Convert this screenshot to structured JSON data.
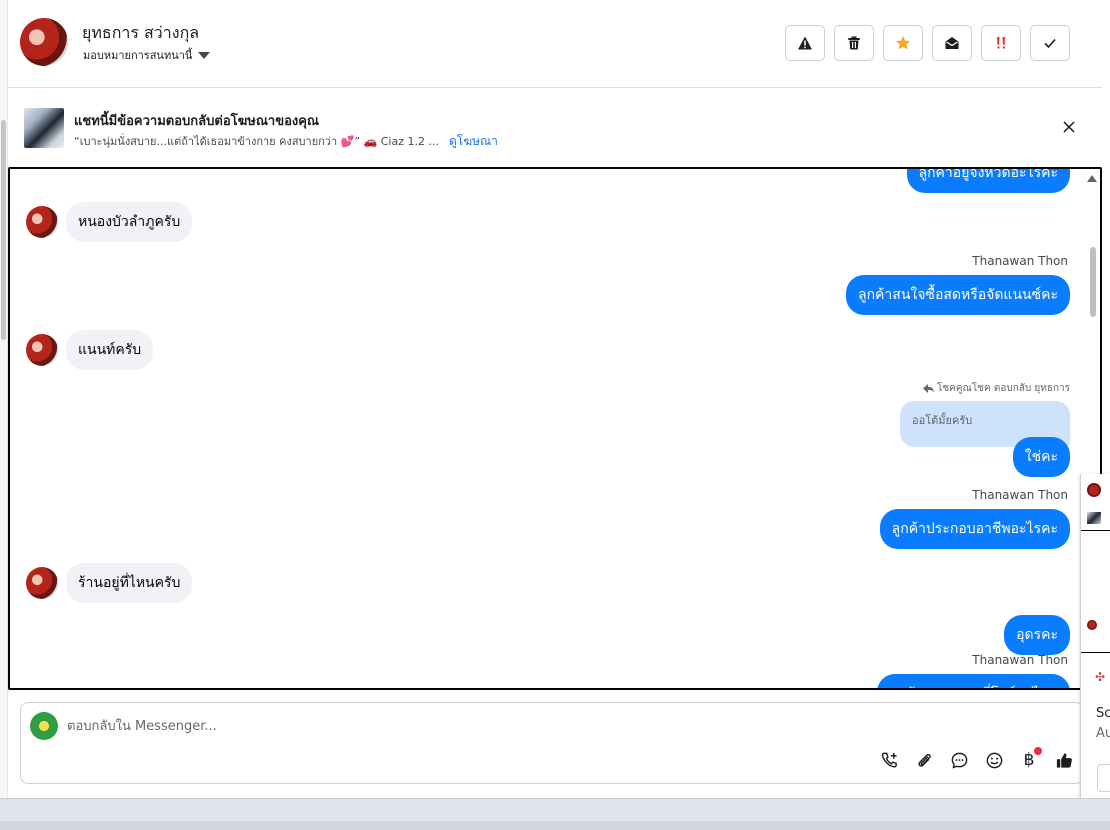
{
  "header": {
    "name": "ยุทธการ สว่างกุล",
    "assignment": "มอบหมายการสนทนานี้"
  },
  "toolbar": [
    {
      "name": "warning-icon",
      "label": "Report"
    },
    {
      "name": "trash-icon",
      "label": "Delete"
    },
    {
      "name": "star-icon",
      "label": "Star"
    },
    {
      "name": "envelope-open-icon",
      "label": "Mark unread"
    },
    {
      "name": "double-exclamation-icon",
      "label": "Follow up"
    },
    {
      "name": "check-icon",
      "label": "Done"
    }
  ],
  "ad_banner": {
    "title": "แชทนี้มีข้อความตอบกลับต่อโฆษณาของคุณ",
    "caption": "“เบาะนุ่มนั่งสบาย...แต่ถ้าได้เธอมาข้างกาย คงสบายกว่า 💕” 🚗 Ciaz 1.2 ...",
    "link": "ดูโฆษณา"
  },
  "messages": {
    "m0": "ลูกค้าอยู่จังหวัดอะไรคะ",
    "m1": "หนองบัวลำภูครับ",
    "s2": "Thanawan Thon",
    "m2": "ลูกค้าสนใจซื้อสดหรือจัดแนนซ์คะ",
    "m3": "แนนท์ครับ",
    "reply_meta": "โชคคูณโชค ตอบกลับ ยุทธการ",
    "quoted": "ออโต้มั้ยครับ",
    "m4": "ใช่คะ",
    "s5": "Thanawan Thon",
    "m5": "ลูกค้าประกอบอาชีพอะไรคะ",
    "m6": "ร้านอยู่ที่ไหนครับ",
    "m7": "อุดรคะ",
    "s8": "Thanawan Thon",
    "m8": "ลูกค้าสะดวกมาที่โชว์รูมไหม"
  },
  "composer": {
    "placeholder": "ตอบกลับใน Messenger..."
  },
  "side_panel": {
    "sc": "Sc",
    "au": "Au"
  },
  "colors": {
    "outgoing_bubble": "#0a7cff",
    "incoming_bubble": "#f0f2f5",
    "quoted_bubble": "#cfe2fb",
    "star": "#f5a623",
    "alert": "#e03131"
  }
}
